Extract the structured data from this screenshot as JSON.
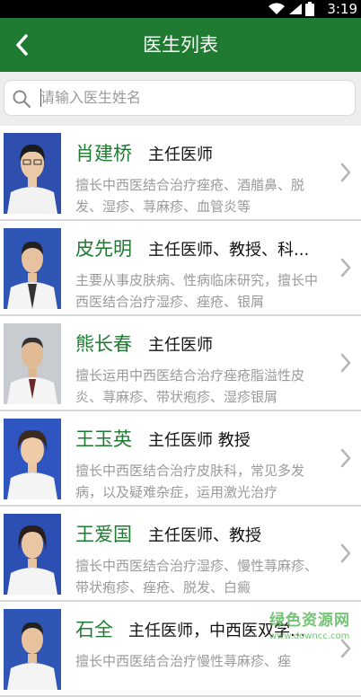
{
  "status_bar": {
    "time": "3:19"
  },
  "header": {
    "title": "医生列表"
  },
  "search": {
    "placeholder": "请输入医生姓名"
  },
  "doctors": [
    {
      "name": "肖建桥",
      "title": "主任医师",
      "description": "擅长中西医结合治疗痤疮、酒艏鼻、脱发、湿疹、荨麻疹、血管炎等"
    },
    {
      "name": "皮先明",
      "title": "主任医师、教授、科...",
      "description": "主要从事皮肤病、性病临床研究，擅长中西医结合治疗湿疹、痤疮、银屑"
    },
    {
      "name": "熊长春",
      "title": "主任医师",
      "description": "擅长运用中西医结合治疗痤疮脂溢性皮炎、荨麻疹、带状疱疹、湿疹银屑"
    },
    {
      "name": "王玉英",
      "title": "主任医师 教授",
      "description": "擅长中西医结合治疗皮肤科，常见多发病，以及疑难杂症，运用激光治疗"
    },
    {
      "name": "王爱国",
      "title": "主任医师、教授",
      "description": "擅长中西医结合治疗湿疹、慢性荨麻疹、带状疱疹、痤疮、脱发、白癜"
    },
    {
      "name": "石全",
      "title": "主任医师，中西医双学...",
      "description": "擅长中西医结合治疗慢性荨麻疹、痤"
    }
  ],
  "watermark": {
    "main": "绿色资源网",
    "url": "www.downcc.com"
  }
}
